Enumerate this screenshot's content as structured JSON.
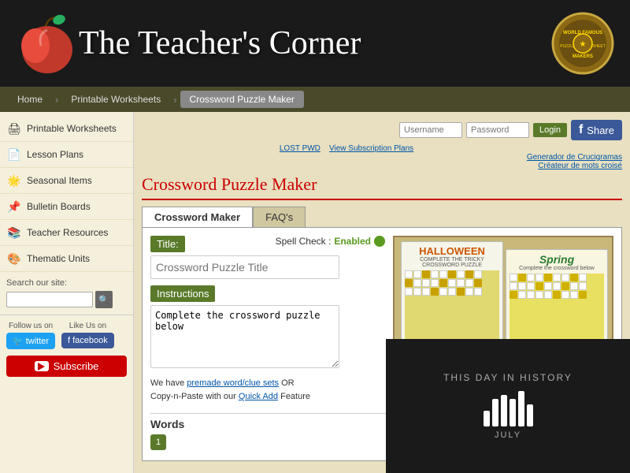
{
  "header": {
    "title": "The Teacher's Corner",
    "logo_alt": "apple logo",
    "badge_alt": "World Famous Puzzle and Worksheet Makers badge"
  },
  "navbar": {
    "items": [
      {
        "label": "Home",
        "active": false
      },
      {
        "label": "Printable Worksheets",
        "active": false
      },
      {
        "label": "Crossword Puzzle Maker",
        "active": true
      }
    ]
  },
  "sidebar": {
    "items": [
      {
        "label": "Printable Worksheets",
        "icon": "🖨"
      },
      {
        "label": "Lesson Plans",
        "icon": "📄"
      },
      {
        "label": "Seasonal Items",
        "icon": "🌟"
      },
      {
        "label": "Bulletin Boards",
        "icon": "📌"
      },
      {
        "label": "Teacher Resources",
        "icon": "📚"
      },
      {
        "label": "Thematic Units",
        "icon": "🎨"
      }
    ],
    "search_label": "Search our site:",
    "search_placeholder": "",
    "follow_label": "Follow us on",
    "like_label": "Like Us on",
    "twitter_label": "twitter",
    "facebook_label": "facebook",
    "subscribe_label": "Subscribe"
  },
  "content": {
    "page_title": "Crossword Puzzle Maker",
    "login_username_placeholder": "Username",
    "login_password_placeholder": "Password",
    "login_button": "Login",
    "share_button": "Share",
    "subscription_link": "View Subscription Plans",
    "lost_pwd_link": "LOST PWD",
    "spanish_link1": "Generador de Crucigramas",
    "spanish_link2": "Créateur de mots croisé",
    "tabs": [
      {
        "label": "Crossword Maker",
        "active": true
      },
      {
        "label": "FAQ's",
        "active": false
      }
    ],
    "title_label": "Title:",
    "title_placeholder": "Crossword Puzzle Title",
    "spell_check_text": "Spell Check :",
    "spell_check_status": "Enabled",
    "instructions_label": "Instructions",
    "instructions_default": "Complete the crossword puzzle below",
    "premade_text": "We have",
    "premade_link": "premade word/clue sets",
    "premade_or": "OR",
    "copy_text": "Copy-n-Paste with our",
    "quick_add_link": "Quick Add",
    "feature_text": "Feature",
    "words_label": "Words",
    "word_number": "1"
  },
  "video_overlay": {
    "title": "THIS DAY IN HISTORY",
    "date": "JULY"
  },
  "preview": {
    "card1_title": "HALLOWEEN",
    "card1_subtitle": "COMPLETE THE TRICKY CROSSWORD PUZZLE",
    "card2_title": "Spring",
    "card2_subtitle": "Complete the crossword below"
  }
}
